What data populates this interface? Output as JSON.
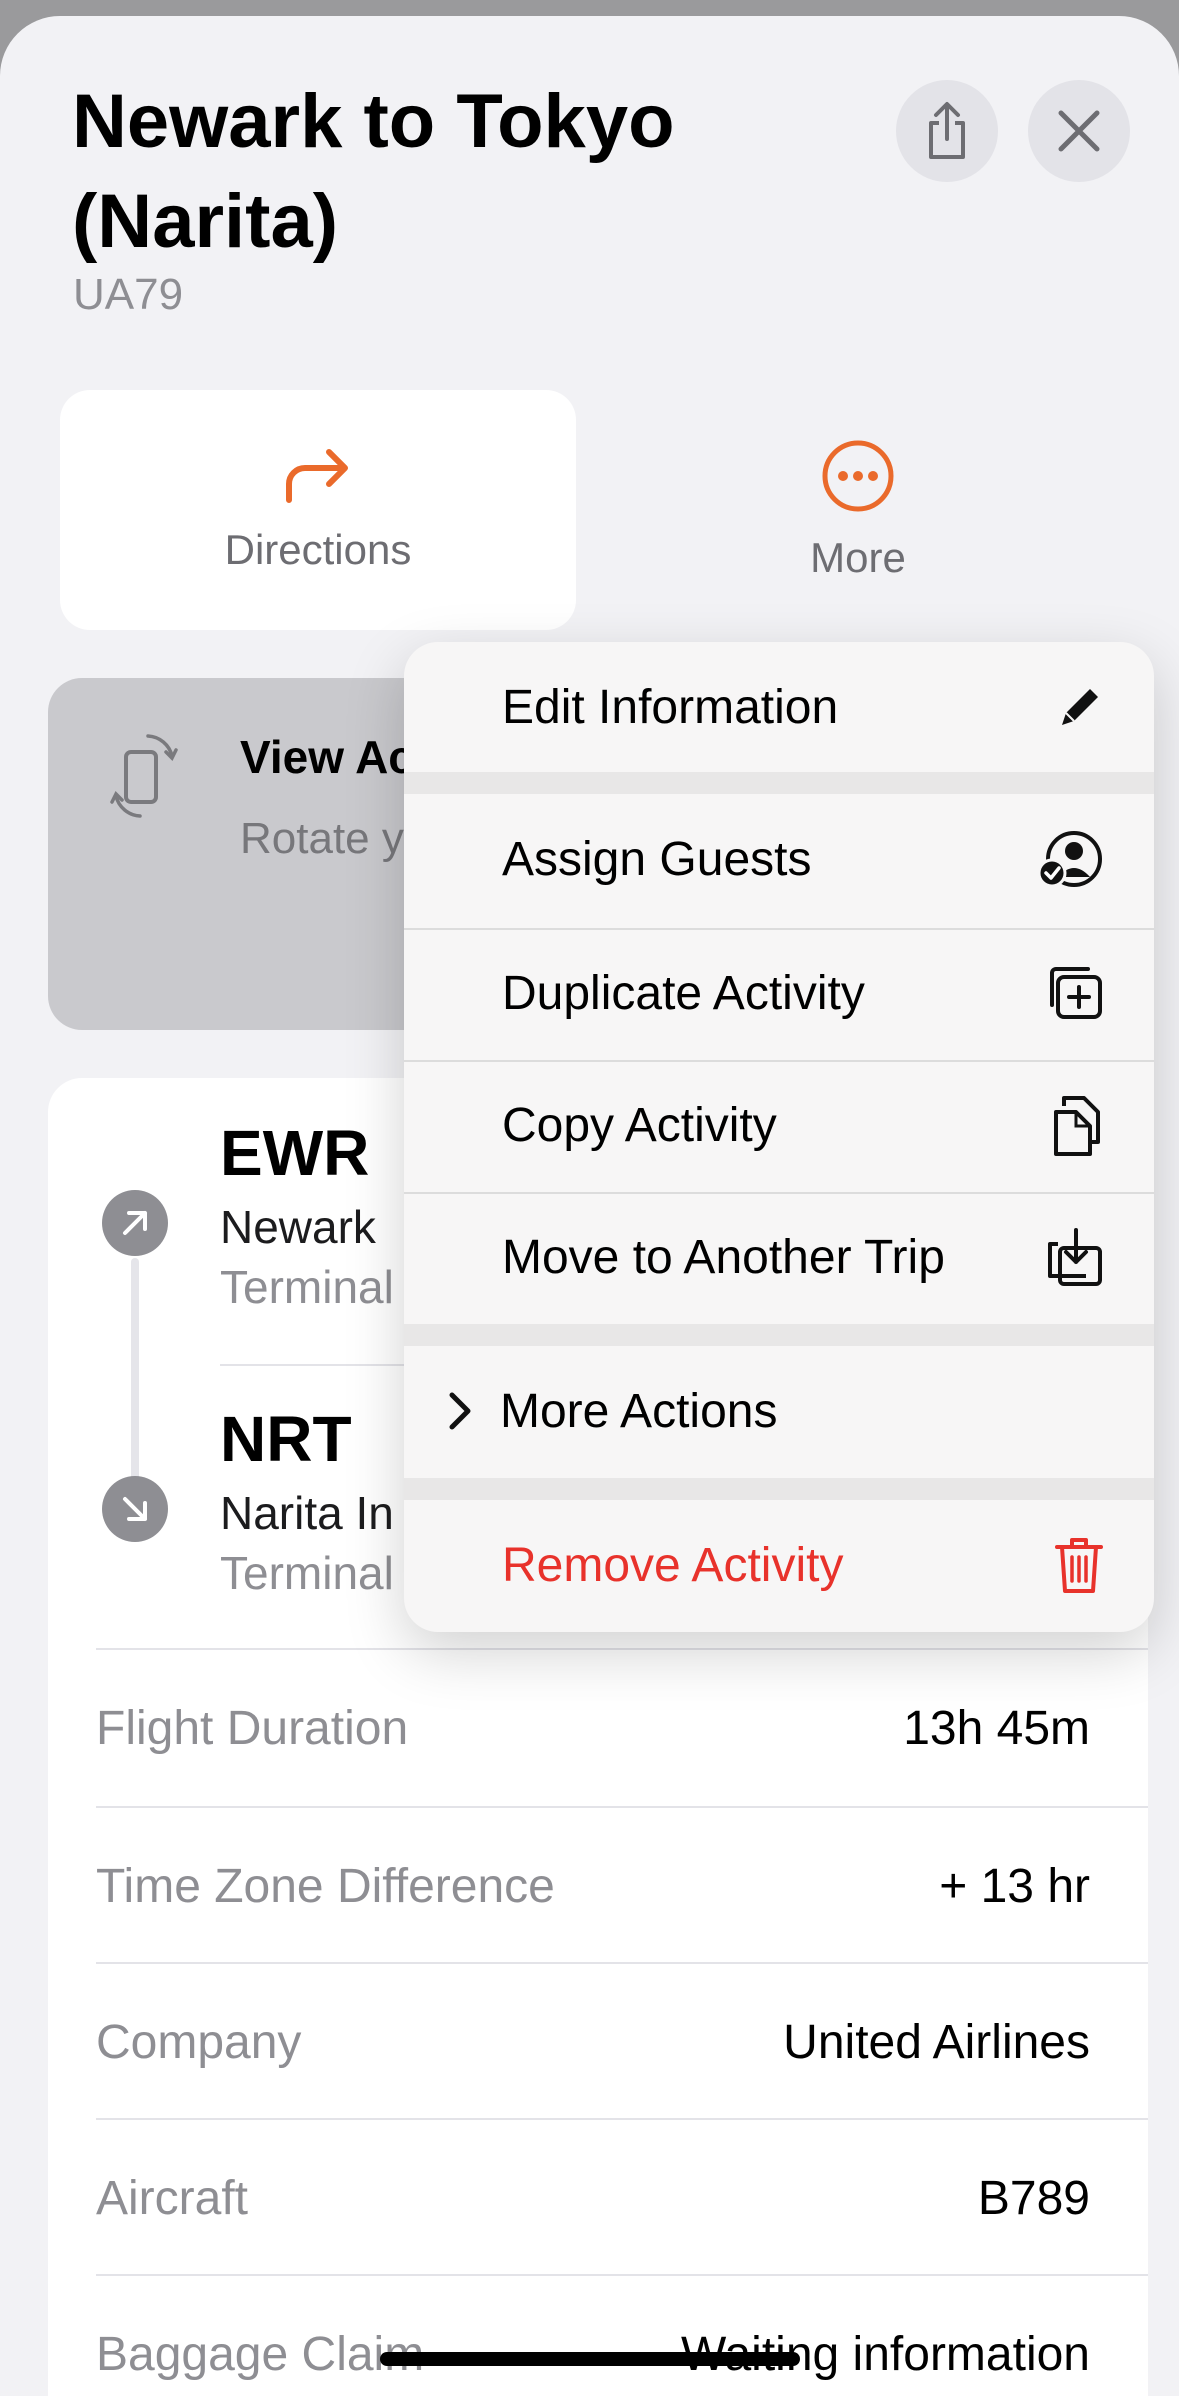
{
  "header": {
    "title": "Newark to Tokyo (Narita)",
    "flight_number": "UA79"
  },
  "actions": {
    "directions_label": "Directions",
    "more_label": "More"
  },
  "tip": {
    "title_visible": "View Ac",
    "body_visible": "Rotate y view of to share"
  },
  "route": {
    "departure": {
      "code": "EWR",
      "airport_visible": "Newark",
      "terminal_visible": "Terminal"
    },
    "arrival": {
      "code": "NRT",
      "airport_visible": "Narita In",
      "terminal_visible": "Terminal"
    }
  },
  "details": [
    {
      "label": "Flight Duration",
      "value": "13h 45m"
    },
    {
      "label": "Time Zone Difference",
      "value": "+ 13 hr"
    },
    {
      "label": "Company",
      "value": "United Airlines"
    },
    {
      "label": "Aircraft",
      "value": "B789"
    },
    {
      "label": "Baggage Claim",
      "value": "Waiting information"
    }
  ],
  "menu": {
    "edit": "Edit Information",
    "assign": "Assign Guests",
    "duplicate": "Duplicate Activity",
    "copy": "Copy Activity",
    "move": "Move to Another Trip",
    "more_actions": "More Actions",
    "remove": "Remove Activity"
  },
  "colors": {
    "accent": "#ea6a2b",
    "destructive": "#e8322b"
  }
}
